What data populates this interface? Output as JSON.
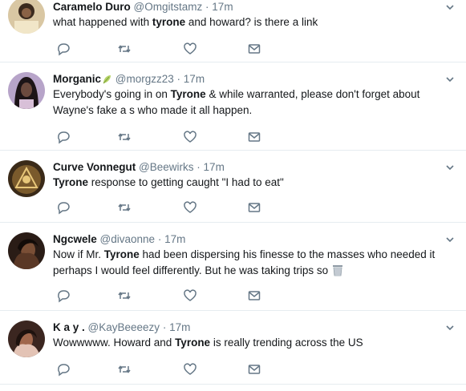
{
  "tweets": [
    {
      "name": "Caramelo Duro",
      "handle": "@Omgitstamz",
      "dot": "·",
      "time": "17m",
      "parts": [
        "what happened with ",
        "tyrone",
        " and howard? is there a link"
      ]
    },
    {
      "name": "Morganic",
      "handle": "@morgzz23",
      "dot": "·",
      "time": "17m",
      "line1": [
        "Everybody's going in on ",
        "Tyrone",
        " & while warranted, please don't forget about"
      ],
      "line2": "Wayne's fake a  s who made it all happen."
    },
    {
      "name": "Curve Vonnegut",
      "handle": "@Beewirks",
      "dot": "·",
      "time": "17m",
      "parts": [
        "Tyrone",
        " response to getting caught \"I had to eat\""
      ]
    },
    {
      "name": "Ngcwele",
      "handle": "@divaonne",
      "dot": "·",
      "time": "17m",
      "line1": [
        "Now if Mr. ",
        "Tyrone",
        " had been dispersing his finesse to the masses who needed it"
      ],
      "line2": "perhaps I would feel differently. But he was taking trips so"
    },
    {
      "name": "K a y .",
      "handle": "@KayBeeeezy",
      "dot": "·",
      "time": "17m",
      "parts": [
        "Wowwwww. Howard and ",
        "Tyrone",
        " is really trending across the US"
      ]
    }
  ],
  "icons": {
    "reply": "reply-icon",
    "retweet": "retweet-icon",
    "like": "heart-icon",
    "dm": "envelope-icon",
    "caret": "chevron-down-icon",
    "leaf": "leaf-emoji-icon",
    "trash": "wastebasket-emoji-icon"
  },
  "colors": {
    "text": "#14171a",
    "muted": "#657786",
    "divider": "#e6ecf0"
  }
}
